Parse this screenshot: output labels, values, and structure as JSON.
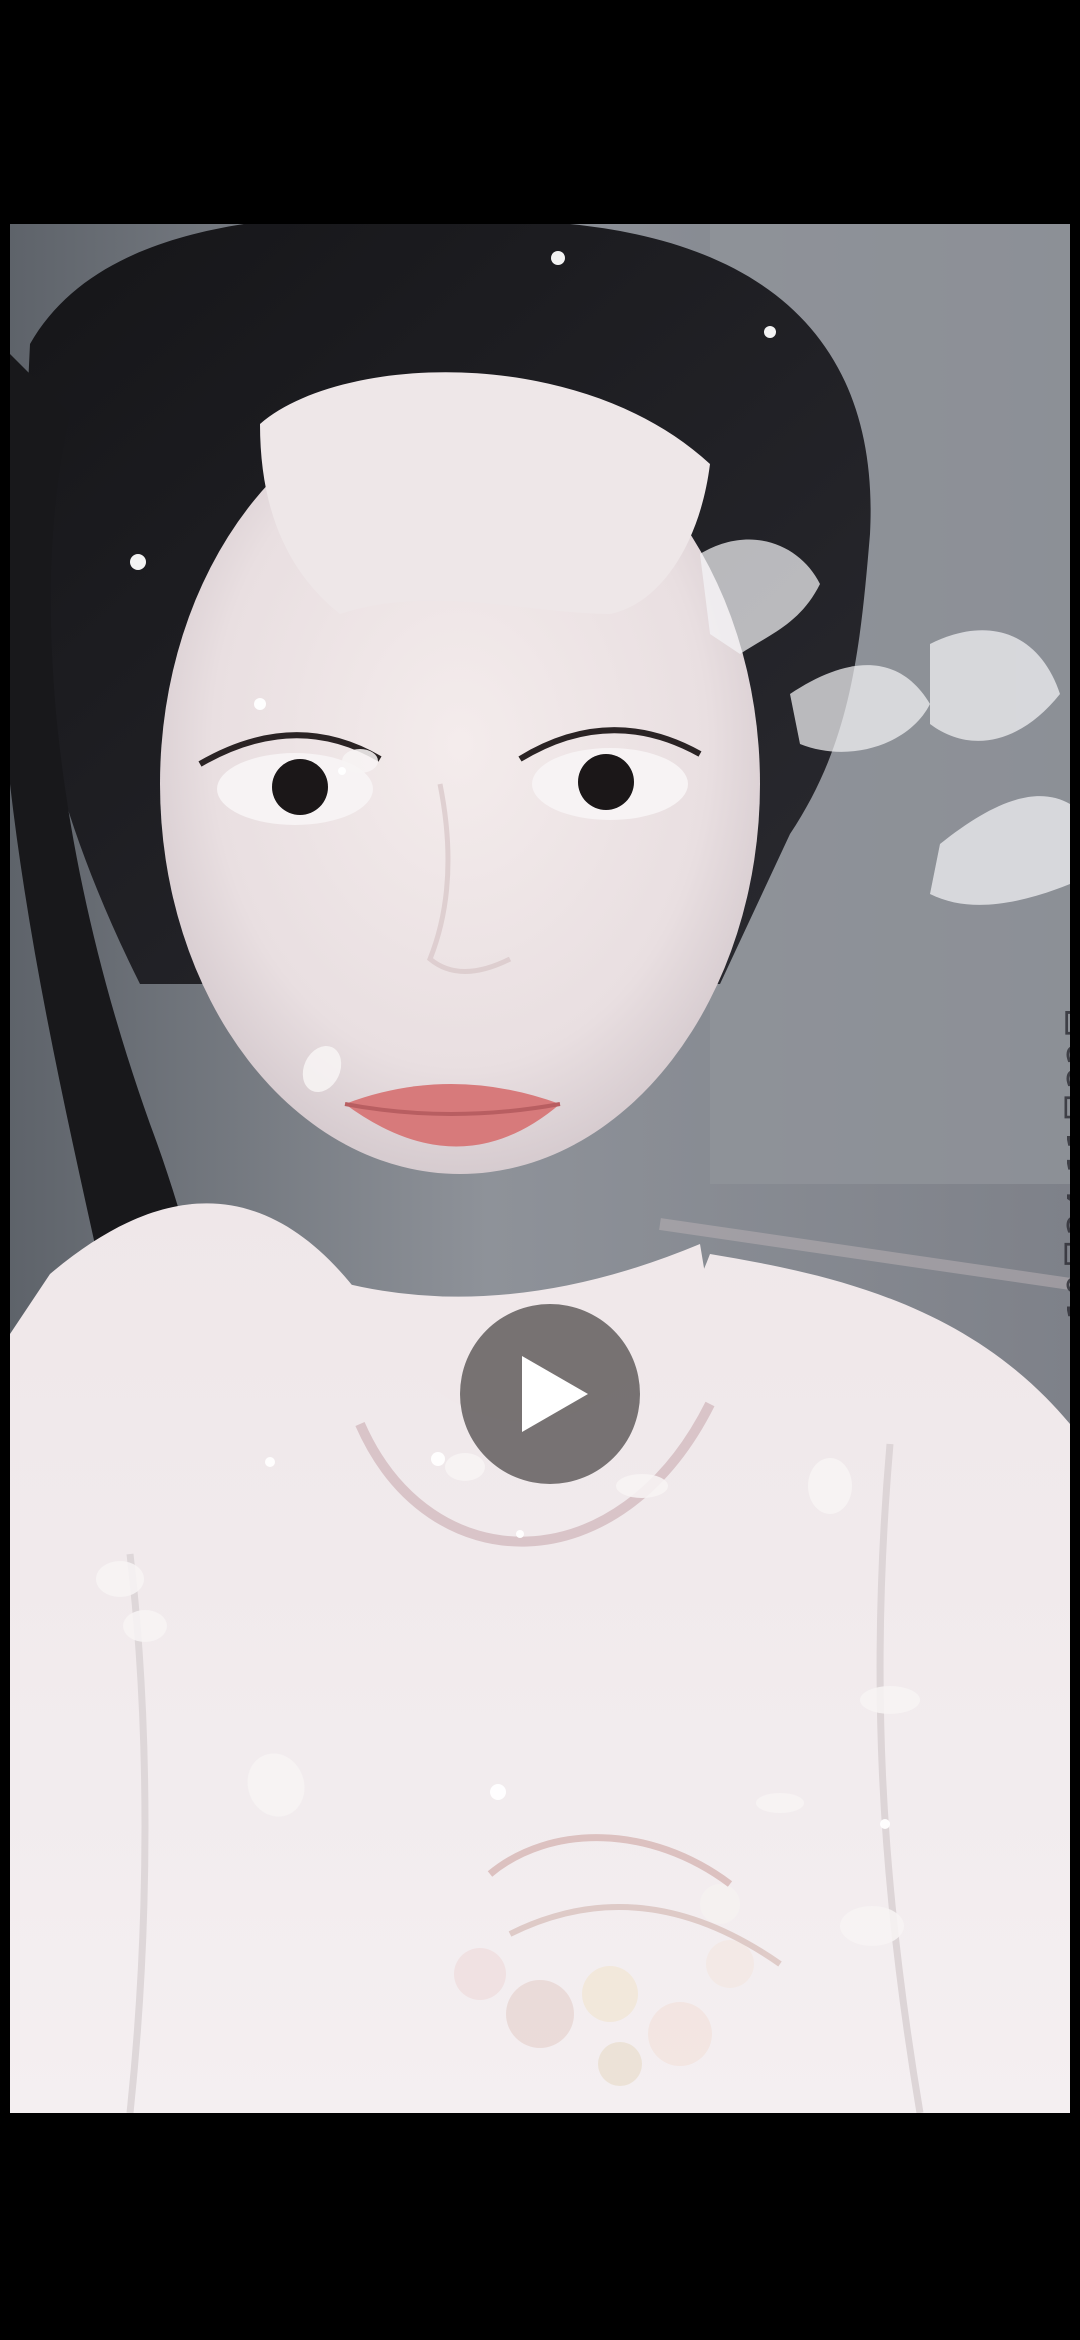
{
  "video": {
    "poster_caption": "10月24-11月22日",
    "play_label": ""
  },
  "colors": {
    "background": "#000000",
    "play_button": "#5c5858",
    "play_icon": "#ffffff"
  },
  "icons": {
    "play": "play-icon"
  }
}
